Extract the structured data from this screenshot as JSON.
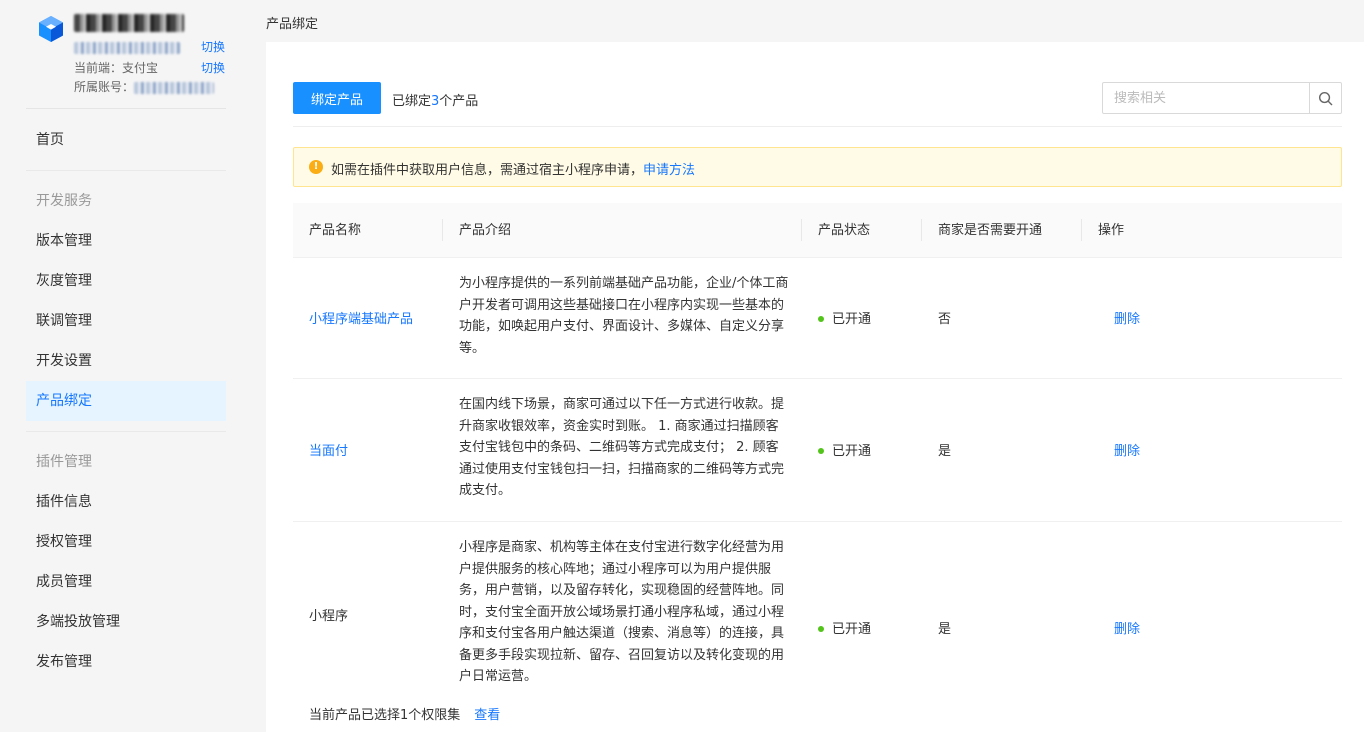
{
  "sidebar": {
    "app": {
      "name": "",
      "id": "",
      "switch_label": "切换",
      "current_end_label": "当前端：支付宝",
      "switch_end_label": "切换",
      "account_label": "所属账号：",
      "account_value": ""
    },
    "home": "首页",
    "group_dev": "开发服务",
    "dev_items": [
      "版本管理",
      "灰度管理",
      "联调管理",
      "开发设置",
      "产品绑定"
    ],
    "group_plugin": "插件管理",
    "plugin_items": [
      "插件信息",
      "授权管理",
      "成员管理",
      "多端投放管理",
      "发布管理"
    ],
    "active_item": "产品绑定"
  },
  "breadcrumb": "产品绑定",
  "toolbar": {
    "bind_button": "绑定产品",
    "bound_prefix": "已绑定",
    "bound_count": "3",
    "bound_suffix": "个产品",
    "search_placeholder": "搜索相关"
  },
  "alert": {
    "text": "如需在插件中获取用户信息，需通过宿主小程序申请，",
    "link": "申请方法"
  },
  "table": {
    "headers": [
      "产品名称",
      "产品介绍",
      "产品状态",
      "商家是否需要开通",
      "操作"
    ],
    "rows": [
      {
        "name": "小程序端基础产品",
        "desc": "为小程序提供的一系列前端基础产品功能，企业/个体工商户开发者可调用这些基础接口在小程序内实现一些基本的功能，如唤起用户支付、界面设计、多媒体、自定义分享等。",
        "status": "已开通",
        "need": "否",
        "action": "删除"
      },
      {
        "name": "当面付",
        "desc": "在国内线下场景，商家可通过以下任一方式进行收款。提升商家收银效率，资金实时到账。 1. 商家通过扫描顾客支付宝钱包中的条码、二维码等方式完成支付； 2. 顾客通过使用支付宝钱包扫一扫，扫描商家的二维码等方式完成支付。",
        "status": "已开通",
        "need": "是",
        "action": "删除"
      },
      {
        "name": "小程序",
        "desc": "小程序是商家、机构等主体在支付宝进行数字化经营为用户提供服务的核心阵地；通过小程序可以为用户提供服务，用户营销，以及留存转化，实现稳固的经营阵地。同时，支付宝全面开放公域场景打通小程序私域，通过小程序和支付宝各用户触达渠道（搜索、消息等）的连接，具备更多手段实现拉新、留存、召回复访以及转化变现的用户日常运营。",
        "status": "已开通",
        "need": "是",
        "action": "删除"
      }
    ],
    "permission_text": "当前产品已选择1个权限集",
    "permission_link": "查看"
  },
  "colors": {
    "accent": "#1677ff",
    "button": "#1890ff",
    "active_bg": "#e6f4ff",
    "status_dot": "#52c41a",
    "alert_bg": "#fffbe6",
    "alert_icon": "#faad14"
  }
}
